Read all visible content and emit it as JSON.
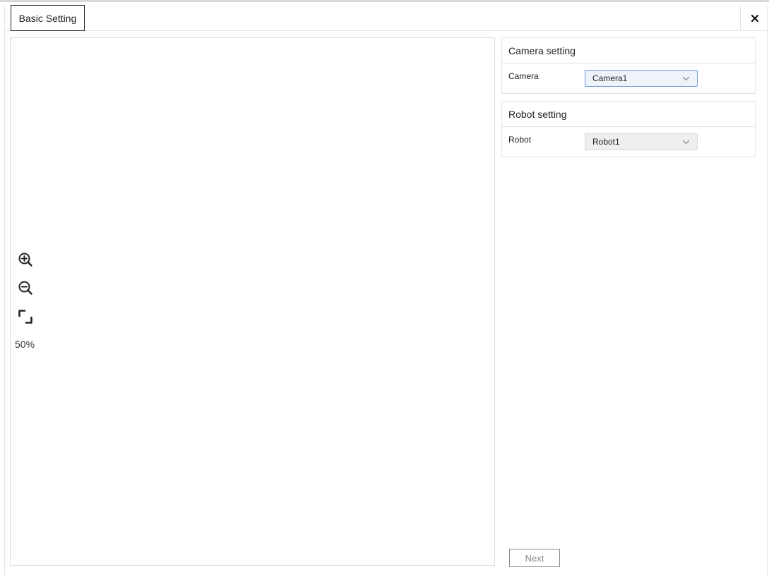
{
  "tab": {
    "label": "Basic Setting"
  },
  "viewer": {
    "zoom_level": "50%",
    "tools": [
      "zoom-in-icon",
      "zoom-out-icon",
      "fit-view-icon"
    ]
  },
  "camera_panel": {
    "title": "Camera setting",
    "label": "Camera",
    "selected": "Camera1"
  },
  "robot_panel": {
    "title": "Robot setting",
    "label": "Robot",
    "selected": "Robot1"
  },
  "footer": {
    "next_label": "Next"
  },
  "colors": {
    "accent_border": "#6a9bd6",
    "accent_fill": "#eef3fa",
    "muted_text": "#888888"
  }
}
